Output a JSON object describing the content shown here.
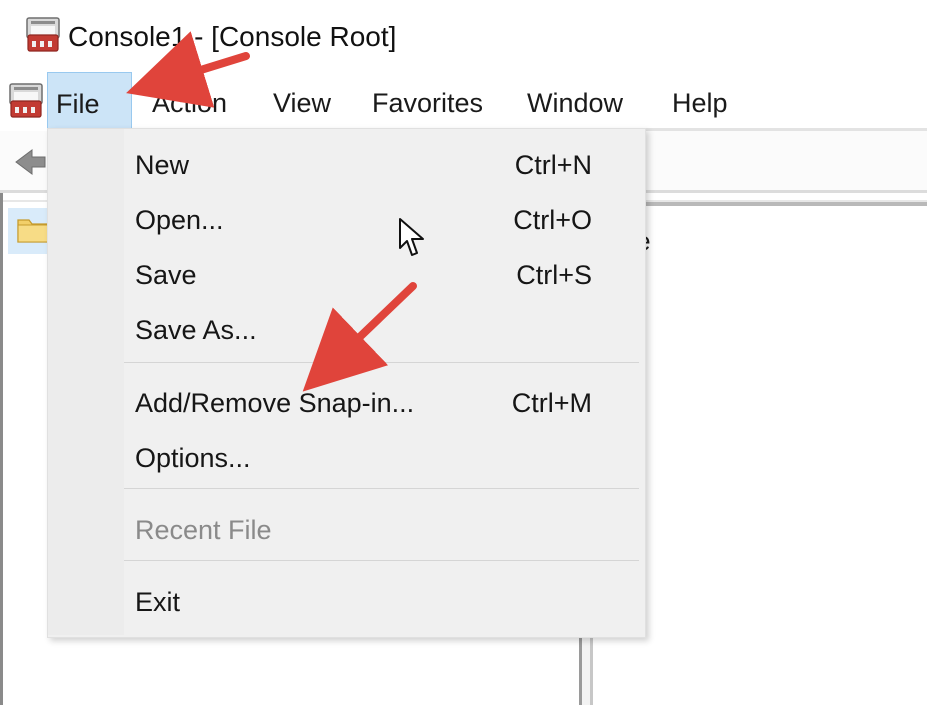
{
  "window": {
    "title": "Console1 - [Console Root]",
    "title_icon": "console-toolbox-icon"
  },
  "menubar": {
    "icon": "console-toolbox-icon",
    "items": [
      {
        "label": "File",
        "active": true
      },
      {
        "label": "Action"
      },
      {
        "label": "View"
      },
      {
        "label": "Favorites"
      },
      {
        "label": "Window"
      },
      {
        "label": "Help"
      }
    ]
  },
  "toolbar": {
    "back_icon": "back-arrow-icon"
  },
  "tree": {
    "selected_icon": "folder-icon"
  },
  "right_panel": {
    "column_header_visible": "ame"
  },
  "file_menu": {
    "items": [
      {
        "label": "New",
        "shortcut": "Ctrl+N"
      },
      {
        "label": "Open...",
        "shortcut": "Ctrl+O"
      },
      {
        "label": "Save",
        "shortcut": "Ctrl+S"
      },
      {
        "label": "Save As..."
      },
      {
        "label": "Add/Remove Snap-in...",
        "shortcut": "Ctrl+M"
      },
      {
        "label": "Options..."
      },
      {
        "label": "Recent File",
        "disabled": true
      },
      {
        "label": "Exit"
      }
    ]
  },
  "annotations": {
    "arrow_color": "#e0443b",
    "cursor_icon": "mouse-pointer-icon"
  },
  "colors": {
    "menu_active_bg": "#cce4f7",
    "menu_bg": "#f0f0f0",
    "disabled_text": "#8a8a8a"
  }
}
